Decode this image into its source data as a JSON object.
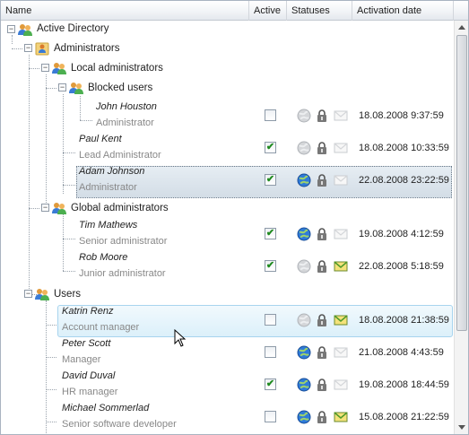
{
  "columns": {
    "name": "Name",
    "active": "Active",
    "statuses": "Statuses",
    "activation_date": "Activation date"
  },
  "tree": {
    "root": "Active Directory",
    "administrators": "Administrators",
    "local_admins": "Local administrators",
    "blocked_users": "Blocked users",
    "global_admins": "Global administrators",
    "users": "Users"
  },
  "people": [
    {
      "name": "John Houston",
      "role": "Administrator",
      "active": false,
      "globe_on": false,
      "mail_on": false,
      "date": "18.08.2008 9:37:59"
    },
    {
      "name": "Paul Kent",
      "role": "Lead Administrator",
      "active": true,
      "globe_on": false,
      "mail_on": false,
      "date": "18.08.2008 10:33:59"
    },
    {
      "name": "Adam Johnson",
      "role": "Administrator",
      "active": true,
      "globe_on": true,
      "mail_on": false,
      "date": "22.08.2008 23:22:59"
    },
    {
      "name": "Tim Mathews",
      "role": "Senior administrator",
      "active": true,
      "globe_on": true,
      "mail_on": false,
      "date": "19.08.2008 4:12:59"
    },
    {
      "name": "Rob Moore",
      "role": "Junior administrator",
      "active": true,
      "globe_on": false,
      "mail_on": true,
      "date": "22.08.2008 5:18:59"
    },
    {
      "name": "Katrin Renz",
      "role": "Account manager",
      "active": false,
      "globe_on": false,
      "mail_on": true,
      "date": "18.08.2008 21:38:59"
    },
    {
      "name": "Peter Scott",
      "role": "Manager",
      "active": false,
      "globe_on": true,
      "mail_on": false,
      "date": "21.08.2008 4:43:59"
    },
    {
      "name": "David Duval",
      "role": "HR manager",
      "active": true,
      "globe_on": true,
      "mail_on": false,
      "date": "19.08.2008 18:44:59"
    },
    {
      "name": "Michael Sommerlad",
      "role": "Senior software developer",
      "active": false,
      "globe_on": true,
      "mail_on": true,
      "date": "15.08.2008 21:22:59"
    }
  ],
  "colors": {
    "header_bg": "#eef1f5",
    "selection_bg": "#d9e2ea",
    "hover_bg": "#e3f3fb",
    "check_green": "#1f8a1f"
  }
}
